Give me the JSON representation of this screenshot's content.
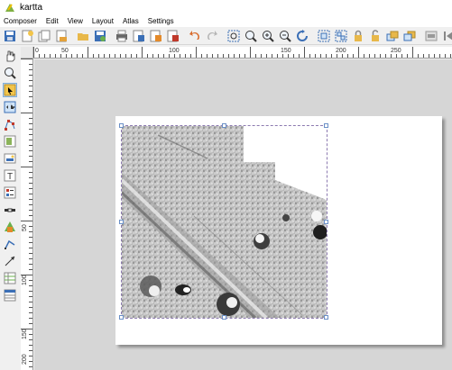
{
  "window": {
    "title": "kartta"
  },
  "menu": [
    "Composer",
    "Edit",
    "View",
    "Layout",
    "Atlas",
    "Settings"
  ],
  "rulers": {
    "horizontal_labels": [
      "50",
      "100",
      "150",
      "200",
      "250"
    ],
    "vertical_labels": [
      "50",
      "100",
      "150",
      "200"
    ],
    "top_left_label": "0"
  },
  "colors": {
    "accent": "#3b6fb6",
    "selection": "#8c7ab0"
  },
  "toolbar_icons": [
    "save-icon",
    "new-composer-icon",
    "duplicate-composer-icon",
    "composer-manager-icon",
    "open-template-icon",
    "save-template-icon",
    "print-icon",
    "export-image-icon",
    "export-svg-icon",
    "export-pdf-icon",
    "undo-icon",
    "redo-icon",
    "zoom-full-icon",
    "zoom-100-icon",
    "zoom-in-icon",
    "zoom-out-icon",
    "refresh-icon",
    "lock-icon",
    "unlock-icon",
    "group-icon",
    "ungroup-icon",
    "raise-icon",
    "atlas-preview-icon",
    "first-feature-icon",
    "previous-feature-icon"
  ],
  "left_tools": [
    "pan-icon",
    "zoom-tool-icon",
    "select-move-icon",
    "move-content-icon",
    "edit-nodes-icon",
    "add-map-icon",
    "add-image-icon",
    "add-text-icon",
    "add-legend-icon",
    "add-scalebar-icon",
    "add-shape-icon",
    "add-arrow-icon",
    "add-table-icon",
    "add-html-icon",
    "add-attribute-table-icon"
  ]
}
